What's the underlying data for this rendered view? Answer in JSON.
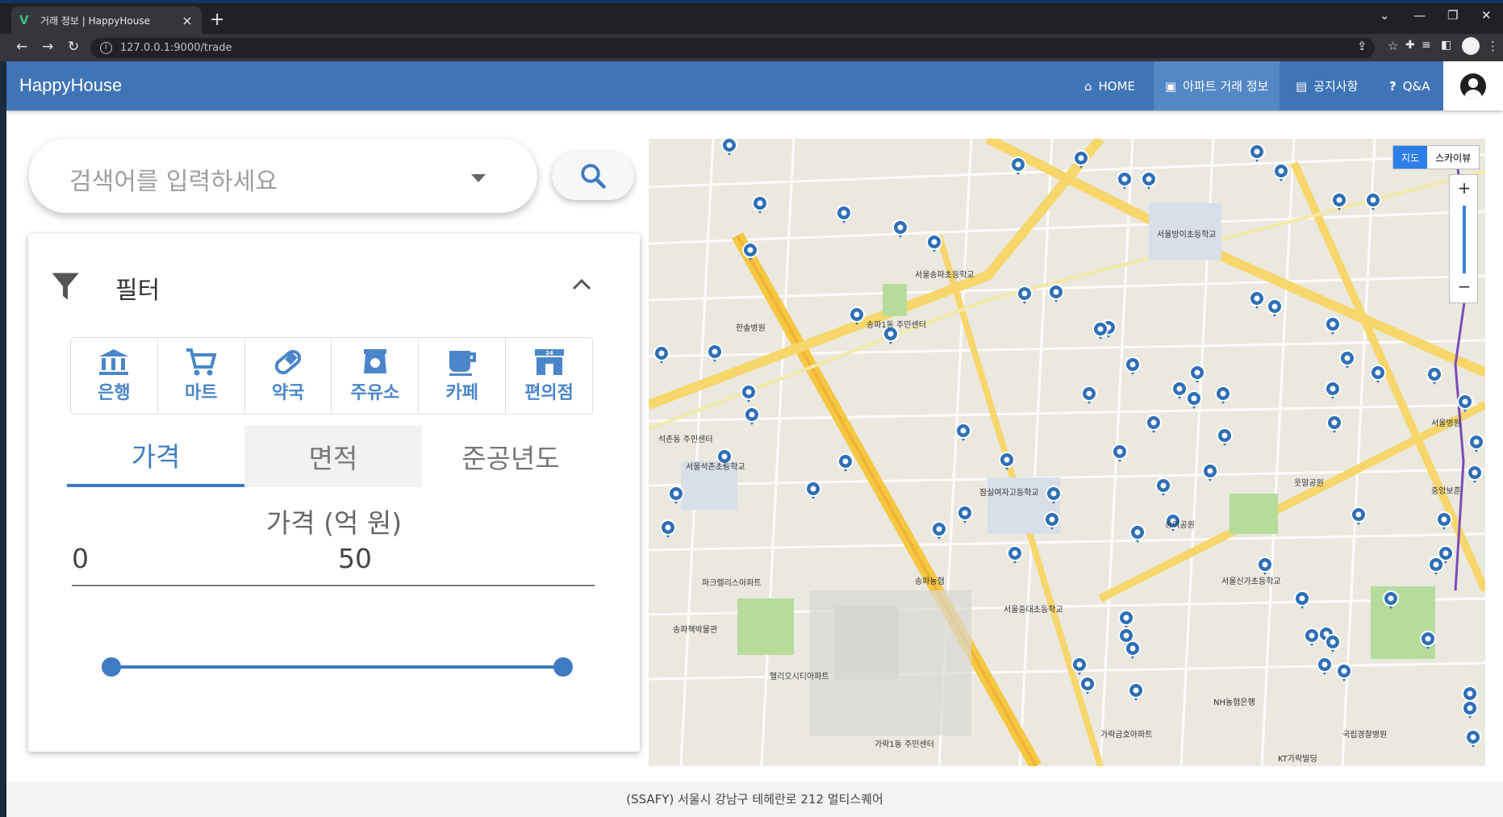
{
  "browser": {
    "tab_title": "거래 정보 | HappyHouse",
    "tab_favicon": "V",
    "new_tab": "+",
    "url": "127.0.0.1:9000/trade"
  },
  "app": {
    "brand": "HappyHouse",
    "menu": [
      {
        "icon": "home-icon",
        "label": "HOME"
      },
      {
        "icon": "apartment-icon",
        "label": "아파트 거래 정보"
      },
      {
        "icon": "notice-icon",
        "label": "공지사항"
      },
      {
        "icon": "question-icon",
        "label": "Q&A"
      }
    ]
  },
  "search": {
    "placeholder": "검색어를 입력하세요"
  },
  "filter": {
    "title": "필터",
    "categories": [
      {
        "icon": "bank-icon",
        "label": "은행"
      },
      {
        "icon": "cart-icon",
        "label": "마트"
      },
      {
        "icon": "pill-icon",
        "label": "약국"
      },
      {
        "icon": "gas-station-icon",
        "label": "주유소"
      },
      {
        "icon": "coffee-icon",
        "label": "카페"
      },
      {
        "icon": "convenience-store-icon",
        "label": "편의점"
      }
    ],
    "tabs": [
      "가격",
      "면적",
      "준공년도"
    ],
    "range": {
      "label": "가격 (억 원)",
      "min": "0",
      "max": "50",
      "slider_low_fraction": 0,
      "slider_high_fraction": 1
    }
  },
  "map": {
    "toggle": [
      "지도",
      "스카이뷰"
    ],
    "zoom_in": "+",
    "zoom_out": "−",
    "labels": [
      "석촌동 주민센터",
      "송파1동 주민센터",
      "서울석촌초등학교",
      "잠실여자고등학교",
      "서울송파초등학교",
      "서울중대초등학교",
      "헬리오시티아파트",
      "가락1동 주민센터",
      "서울방이초등학교",
      "서울신가초등학교",
      "국립경찰병원",
      "서울병원",
      "송파농협",
      "파크렐리스아파트",
      "송파책박물관",
      "가락금호아파트",
      "송이공원",
      "웃말공원",
      "한솔병원",
      "중앙보훈",
      "NH농협은행",
      "KT가락빌딩"
    ]
  },
  "footer": {
    "text": "(SSAFY) 서울시 강남구 테헤란로 212 멀티스퀘어"
  }
}
